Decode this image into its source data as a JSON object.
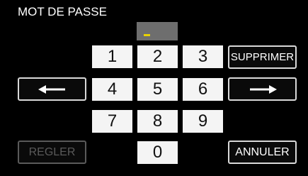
{
  "title": "MOT DE PASSE",
  "keypad": {
    "keys": [
      "1",
      "2",
      "3",
      "4",
      "5",
      "6",
      "7",
      "8",
      "9",
      "0"
    ]
  },
  "buttons": {
    "delete": "SUPPRIMER",
    "set": "REGLER",
    "cancel": "ANNULER"
  },
  "icons": {
    "left": "arrow-left-icon",
    "right": "arrow-right-icon"
  },
  "colors": {
    "background": "#000000",
    "key": "#f4f4f4",
    "cursor": "#e8d200",
    "disabled": "#5a5a5a"
  }
}
